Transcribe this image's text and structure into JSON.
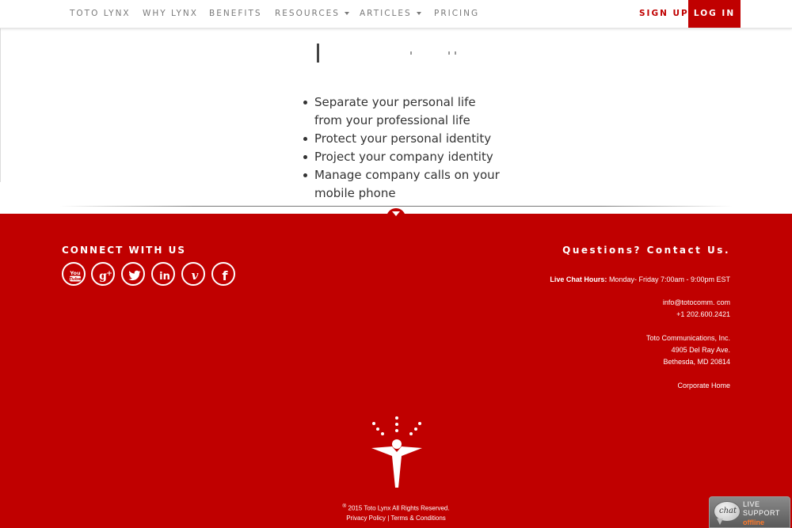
{
  "nav": {
    "items": [
      {
        "label": "TOTO LYNX"
      },
      {
        "label": "WHY LYNX"
      },
      {
        "label": "BENEFITS"
      },
      {
        "label": "RESOURCES"
      },
      {
        "label": "ARTICLES"
      },
      {
        "label": "PRICING"
      }
    ],
    "signup_label": "SIGN UP",
    "login_label": "LOG IN"
  },
  "features": [
    "Separate your personal life from your professional life",
    "Protect your personal identity",
    "Project your company identity",
    "Manage company calls on your mobile phone"
  ],
  "footer": {
    "connect_title": "CONNECT WITH US",
    "social_icons": [
      "youtube-icon",
      "google-plus-icon",
      "twitter-icon",
      "linkedin-icon",
      "vimeo-icon",
      "facebook-icon"
    ],
    "contact_title": "Questions? Contact Us.",
    "chat_hours_label": "Live Chat Hours:",
    "chat_hours_value": "Monday- Friday 7:00am - 9:00pm EST",
    "email": "info@totocomm. com",
    "phone": "+1 202.600.2421",
    "company": "Toto Communications, Inc.",
    "address_street": "4905 Del Ray Ave.",
    "address_city": "Bethesda, MD 20814",
    "corporate_home": "Corporate Home",
    "copyright_mark": "®",
    "copyright_text": "2015 Toto Lynx All Rights Reserved.",
    "privacy_policy": "Privacy Policy",
    "legal_separator": "|",
    "terms": "Terms & Conditions"
  },
  "chat_widget": {
    "bubble_text": "chat",
    "line1": "LIVE",
    "line2": "SUPPORT",
    "status": "offline"
  },
  "colors": {
    "brand_red": "#c00000",
    "nav_text": "#7a7a7a",
    "body_text": "#333333",
    "chat_status": "#ff7a2a"
  }
}
